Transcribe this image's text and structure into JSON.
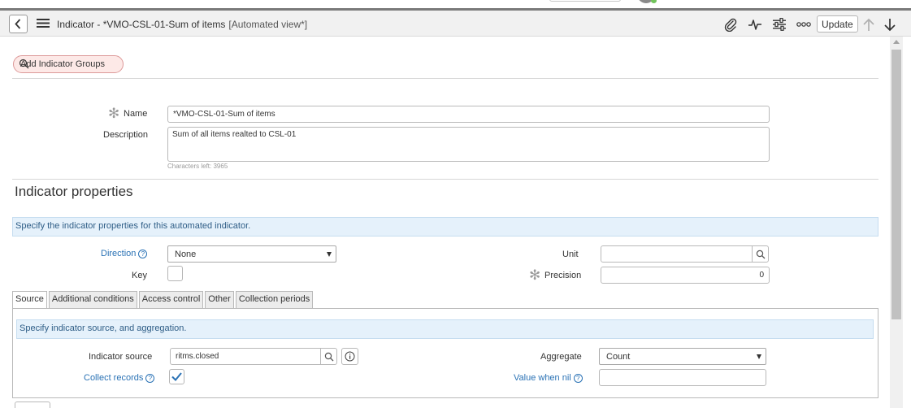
{
  "header": {
    "title": "Indicator - *VMO-CSL-01-Sum of items",
    "view": "[Automated view*]",
    "icons": [
      "chevron-left-icon",
      "hamburger-icon",
      "paperclip-icon",
      "activity-icon",
      "sliders-icon",
      "more-icon",
      "arrow-up-icon",
      "arrow-down-icon"
    ],
    "update_label": "Update"
  },
  "groups": {
    "label": "Add Indicator Groups"
  },
  "form": {
    "name_label": "Name",
    "name_value": "*VMO-CSL-01-Sum of items",
    "description_label": "Description",
    "description_value": "Sum of all items realted to CSL-01",
    "characters_left": "Characters left: 3965"
  },
  "properties": {
    "title": "Indicator properties",
    "banner": "Specify the indicator properties for this automated indicator.",
    "direction_label": "Direction",
    "direction_value": "None",
    "key_label": "Key",
    "key_checked": false,
    "unit_label": "Unit",
    "unit_value": "",
    "precision_label": "Precision",
    "precision_value": "0"
  },
  "tabs": [
    "Source",
    "Additional conditions",
    "Access control",
    "Other",
    "Collection periods"
  ],
  "source": {
    "banner": "Specify indicator source, and aggregation.",
    "indicator_source_label": "Indicator source",
    "indicator_source_value": "ritms.closed",
    "collect_records_label": "Collect records",
    "collect_records_checked": true,
    "aggregate_label": "Aggregate",
    "aggregate_value": "Count",
    "value_when_nil_label": "Value when nil",
    "value_when_nil_value": ""
  },
  "colors": {
    "link": "#2a72b5",
    "banner_bg": "#e5f1fb",
    "pill_bg": "#fde9e7"
  }
}
